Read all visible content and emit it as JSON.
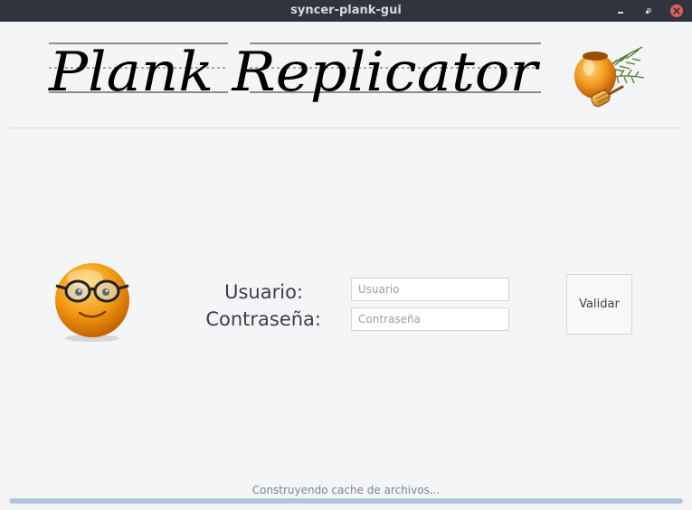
{
  "window": {
    "title": "syncer-plank-gui",
    "controls": [
      "minimize-icon",
      "maximize-icon",
      "close-icon"
    ]
  },
  "header": {
    "logo_text": "Plank Replicator",
    "logo_icon": "honey-jar-icon"
  },
  "login": {
    "avatar_icon": "smiley-glasses-icon",
    "user_label": "Usuario:",
    "user_placeholder": "Usuario",
    "user_value": "",
    "password_label": "Contraseña:",
    "password_placeholder": "Contraseña",
    "password_value": "",
    "validate_label": "Validar"
  },
  "status": {
    "text": "Construyendo cache de archivos...",
    "progress": 1.0
  },
  "colors": {
    "titlebar_bg": "#2f343f",
    "close_button": "#e0605a",
    "window_bg": "#f4f5f7"
  }
}
